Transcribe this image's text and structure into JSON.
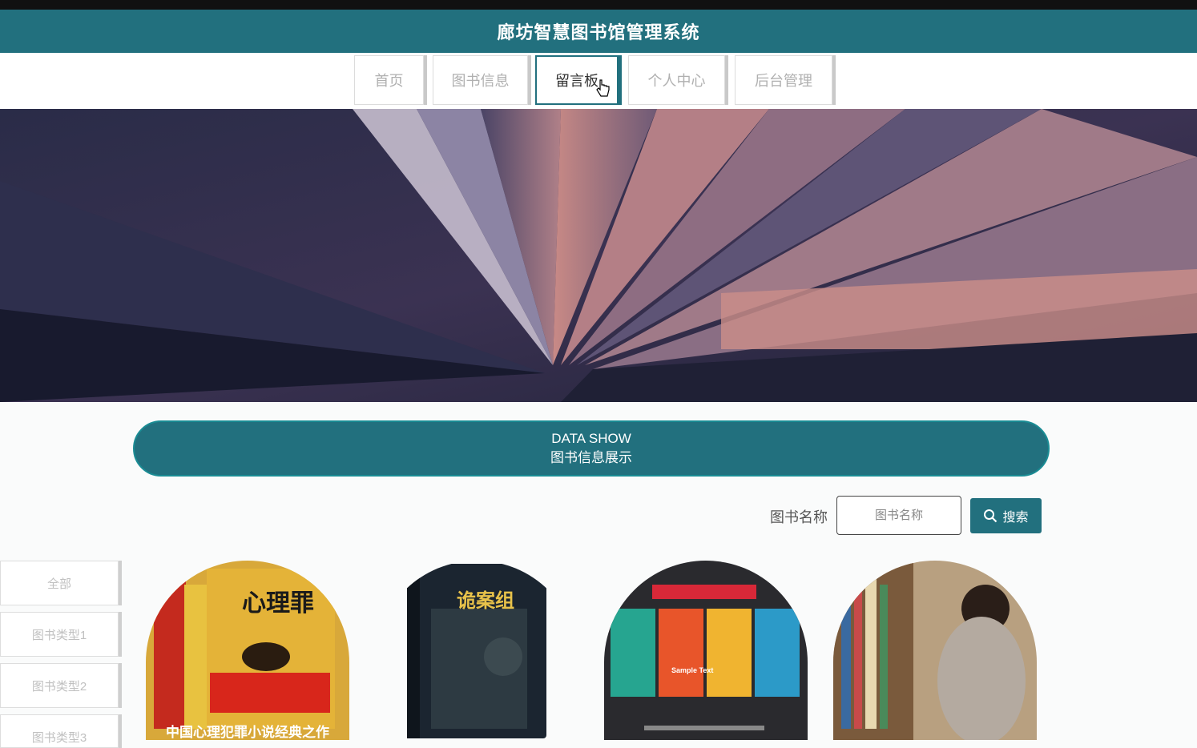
{
  "app": {
    "title": "廊坊智慧图书馆管理系统"
  },
  "nav": [
    {
      "label": "首页"
    },
    {
      "label": "图书信息"
    },
    {
      "label": "留言板",
      "active": true
    },
    {
      "label": "个人中心"
    },
    {
      "label": "后台管理"
    }
  ],
  "section": {
    "en": "DATA SHOW",
    "cn": "图书信息展示"
  },
  "search": {
    "label": "图书名称",
    "placeholder": "图书名称",
    "button": "搜索",
    "icon": "search-icon"
  },
  "categories": [
    {
      "label": "全部"
    },
    {
      "label": "图书类型1"
    },
    {
      "label": "图书类型2"
    },
    {
      "label": "图书类型3"
    }
  ],
  "books": [
    {
      "cover_title": "心理罪",
      "caption": "中国心理犯罪小说经典之作"
    },
    {
      "cover_title": "诡案组"
    },
    {
      "cover_title": "Sample Text"
    },
    {
      "cover_title": ""
    }
  ],
  "colors": {
    "primary": "#22707e",
    "background": "#fafbfb"
  }
}
